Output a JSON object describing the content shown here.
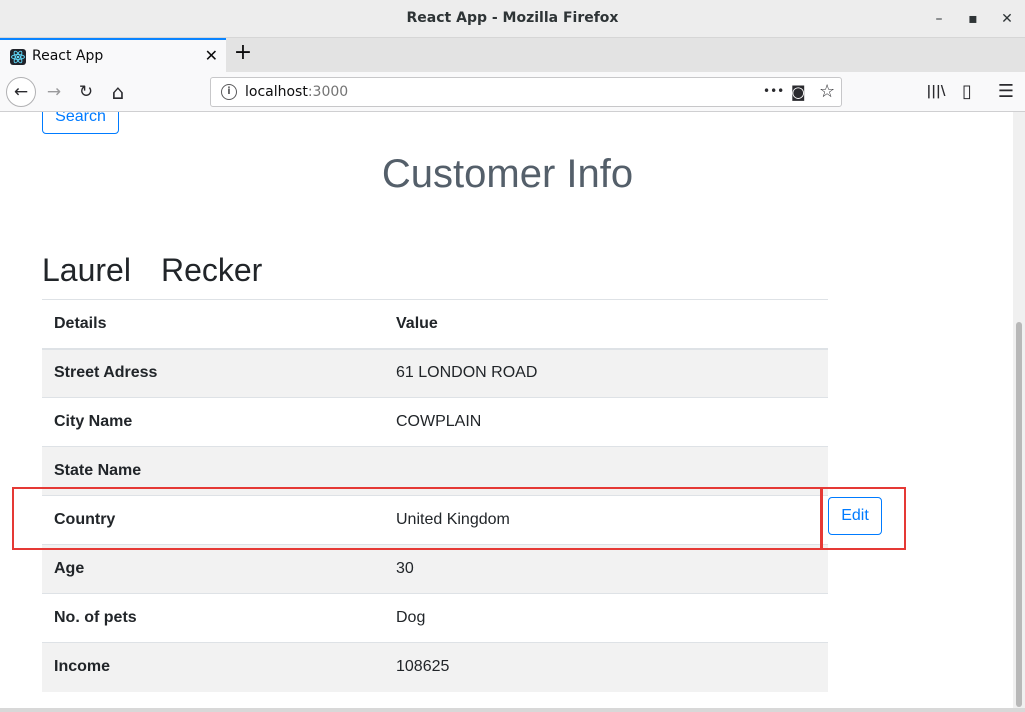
{
  "window": {
    "title": "React App - Mozilla Firefox",
    "minimize": "–",
    "maximize": "▪",
    "close": "✕"
  },
  "tab": {
    "title": "React App",
    "close": "✕",
    "new_tab": "+"
  },
  "nav": {
    "back": "←",
    "forward": "→",
    "reload": "↻",
    "home": "⌂",
    "url_host": "localhost",
    "url_port": ":3000",
    "info_icon": "i",
    "more_icon": "•••",
    "pocket_icon": "◙",
    "star_icon": "☆",
    "library_icon": "|||\\",
    "sidebar_icon": "▯",
    "menu_icon": "☰"
  },
  "page": {
    "search_label": "Search",
    "title": "Customer Info",
    "first_name": "Laurel",
    "last_name": "Recker",
    "table": {
      "headers": [
        "Details",
        "Value"
      ],
      "rows": [
        {
          "key": "Street Adress",
          "value": "61 LONDON ROAD"
        },
        {
          "key": "City Name",
          "value": "COWPLAIN"
        },
        {
          "key": "State Name",
          "value": ""
        },
        {
          "key": "Country",
          "value": "United Kingdom"
        },
        {
          "key": "Age",
          "value": "30"
        },
        {
          "key": "No. of pets",
          "value": "Dog"
        },
        {
          "key": "Income",
          "value": "108625"
        }
      ]
    },
    "edit_label": "Edit"
  },
  "colors": {
    "primary": "#007bff",
    "highlight": "#e53935",
    "title": "#545f6a"
  }
}
